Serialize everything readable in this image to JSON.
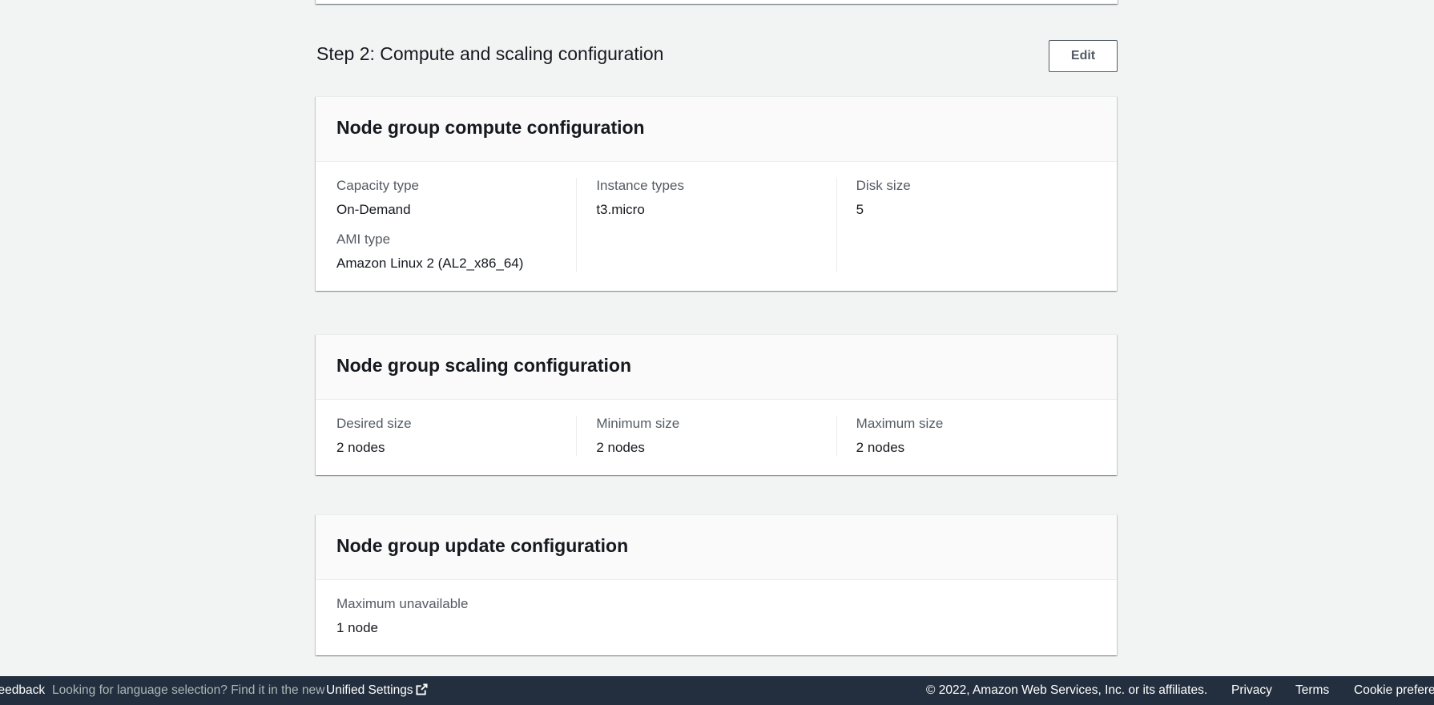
{
  "step": {
    "title": "Step 2: Compute and scaling configuration",
    "edit_label": "Edit"
  },
  "compute": {
    "title": "Node group compute configuration",
    "capacity_type_label": "Capacity type",
    "capacity_type_value": "On-Demand",
    "ami_type_label": "AMI type",
    "ami_type_value": "Amazon Linux 2 (AL2_x86_64)",
    "instance_types_label": "Instance types",
    "instance_types_value": "t3.micro",
    "disk_size_label": "Disk size",
    "disk_size_value": "5"
  },
  "scaling": {
    "title": "Node group scaling configuration",
    "desired_label": "Desired size",
    "desired_value": "2 nodes",
    "minimum_label": "Minimum size",
    "minimum_value": "2 nodes",
    "maximum_label": "Maximum size",
    "maximum_value": "2 nodes"
  },
  "update": {
    "title": "Node group update configuration",
    "max_unavailable_label": "Maximum unavailable",
    "max_unavailable_value": "1 node"
  },
  "footer": {
    "feedback": "Feedback",
    "language_hint": "Looking for language selection? Find it in the new",
    "unified_settings": "Unified Settings",
    "copyright": "© 2022, Amazon Web Services, Inc. or its affiliates.",
    "privacy": "Privacy",
    "terms": "Terms",
    "cookie": "Cookie preferences"
  },
  "colors": {
    "background": "#f2f3f3",
    "footer_bg": "#232f3e",
    "text": "#16191f",
    "label": "#545b64"
  },
  "icons": {
    "external_link": "external-link-icon"
  }
}
